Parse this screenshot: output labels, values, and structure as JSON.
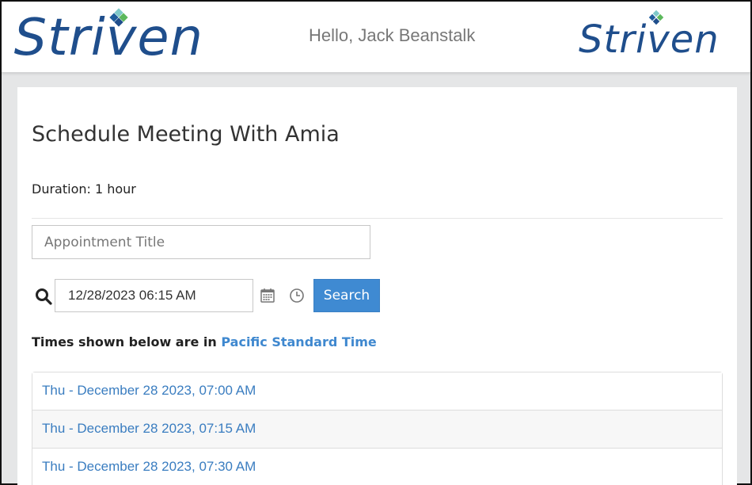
{
  "header": {
    "logo_left": "Striven",
    "logo_right": "Striven",
    "greeting": "Hello, Jack Beanstalk",
    "brand_color": "#1f4e8c"
  },
  "main": {
    "title": "Schedule Meeting With Amia",
    "duration": "Duration: 1 hour",
    "appointment_title": {
      "placeholder": "Appointment Title",
      "value": ""
    },
    "date_search": {
      "value": "12/28/2023 06:15 AM",
      "search_icon": "search-icon",
      "calendar_icon": "calendar-icon",
      "clock_icon": "clock-icon",
      "search_label": "Search"
    },
    "timezone": {
      "prefix": "Times shown below are in",
      "name": "Pacific Standard Time"
    },
    "slots": [
      {
        "label": "Thu - December 28 2023, 07:00 AM"
      },
      {
        "label": "Thu - December 28 2023, 07:15 AM"
      },
      {
        "label": "Thu - December 28 2023, 07:30 AM"
      }
    ],
    "accent_color": "#3f8ad2"
  }
}
